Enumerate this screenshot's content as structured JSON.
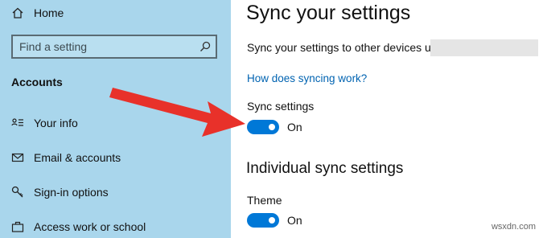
{
  "sidebar": {
    "home_label": "Home",
    "search_placeholder": "Find a setting",
    "section_heading": "Accounts",
    "items": [
      {
        "label": "Your info",
        "icon": "person-list-icon"
      },
      {
        "label": "Email & accounts",
        "icon": "mail-icon"
      },
      {
        "label": "Sign-in options",
        "icon": "key-icon"
      },
      {
        "label": "Access work or school",
        "icon": "briefcase-icon"
      }
    ],
    "background": "#a9d6ec"
  },
  "main": {
    "title": "Sync your settings",
    "description": "Sync your settings to other devices using",
    "help_link": "How does syncing work?",
    "sync_settings": {
      "label": "Sync settings",
      "state": "On"
    },
    "individual_heading": "Individual sync settings",
    "theme": {
      "label": "Theme",
      "state": "On"
    }
  },
  "colors": {
    "accent": "#0078d7",
    "link": "#0063b1",
    "arrow": "#e8312a"
  },
  "watermark": "wsxdn.com"
}
